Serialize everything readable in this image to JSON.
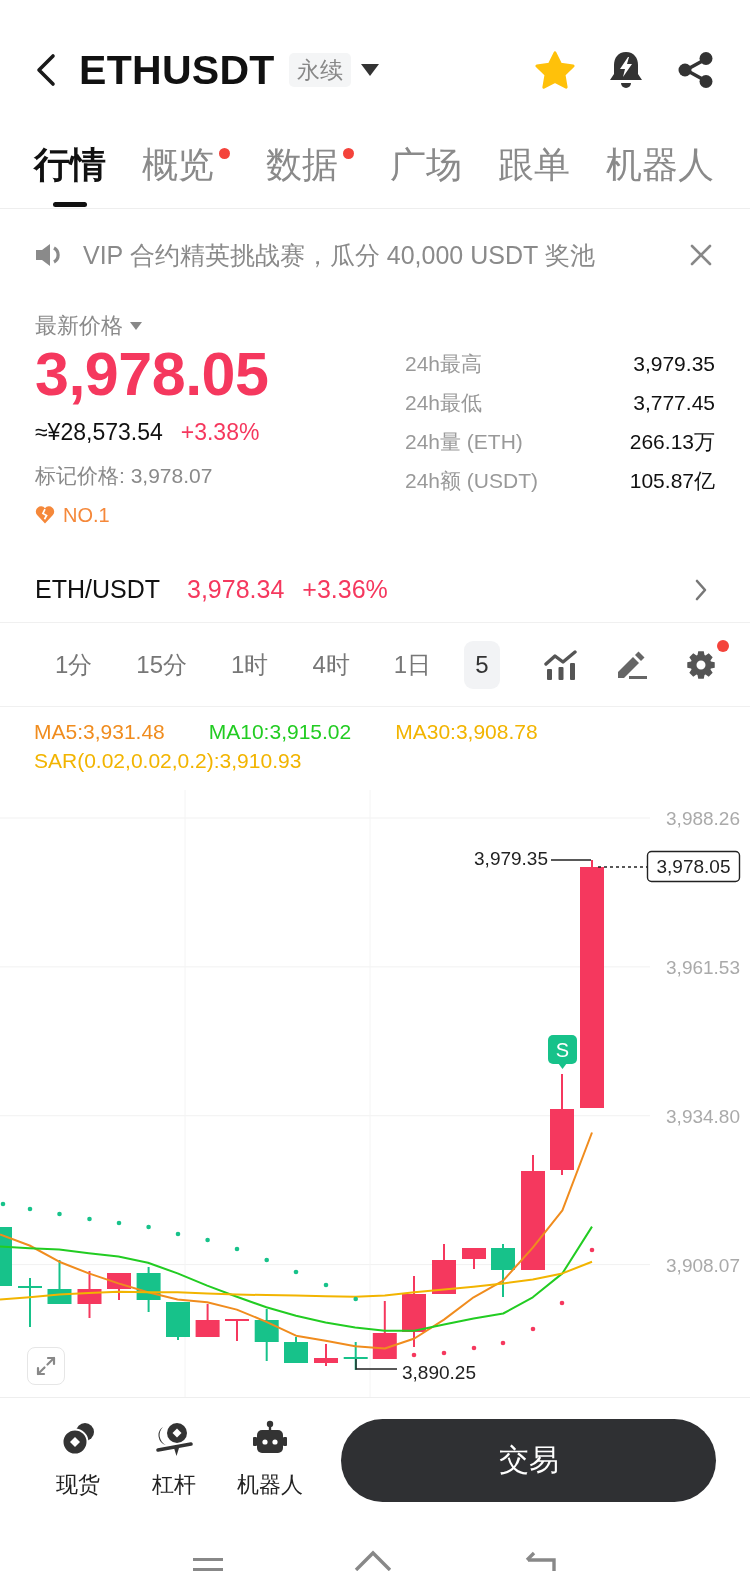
{
  "header": {
    "symbol": "ETHUSDT",
    "tag": "永续",
    "favorited": true
  },
  "tabs": [
    {
      "label": "行情",
      "selected": true,
      "dot": false
    },
    {
      "label": "概览",
      "selected": false,
      "dot": true
    },
    {
      "label": "数据",
      "selected": false,
      "dot": true
    },
    {
      "label": "广场",
      "selected": false,
      "dot": false
    },
    {
      "label": "跟单",
      "selected": false,
      "dot": false
    },
    {
      "label": "机器人",
      "selected": false,
      "dot": false
    }
  ],
  "announcement": {
    "text": "VIP 合约精英挑战赛，瓜分 40,000 USDT 奖池"
  },
  "price": {
    "label": "最新价格",
    "last": "3,978.05",
    "cny": "≈¥28,573.54",
    "change": "+3.38%",
    "mark": "标记价格: 3,978.07",
    "rank": "NO.1"
  },
  "stats": [
    {
      "label": "24h最高",
      "value": "3,979.35"
    },
    {
      "label": "24h最低",
      "value": "3,777.45"
    },
    {
      "label": "24h量 (ETH)",
      "value": "266.13万"
    },
    {
      "label": "24h额 (USDT)",
      "value": "105.87亿"
    }
  ],
  "spot_row": {
    "pair": "ETH/USDT",
    "price": "3,978.34",
    "change": "+3.36%"
  },
  "timeframes": [
    {
      "label": "1分",
      "selected": false
    },
    {
      "label": "15分",
      "selected": false
    },
    {
      "label": "1时",
      "selected": false
    },
    {
      "label": "4时",
      "selected": false
    },
    {
      "label": "1日",
      "selected": false
    },
    {
      "label": "5",
      "selected": true
    }
  ],
  "chart_tools": {
    "settings_dot": true
  },
  "chart": {
    "chart_data": {
      "type": "line",
      "grid": true,
      "ylim": [
        3884.21,
        3988.26
      ],
      "yticks": [
        {
          "value": 3988.26,
          "label": "3,988.26"
        },
        {
          "value": 3961.53,
          "label": "3,961.53"
        },
        {
          "value": 3934.8,
          "label": "3,934.80"
        },
        {
          "value": 3908.07,
          "label": "3,908.07"
        }
      ],
      "series": [
        {
          "name": "MA5:3,931.48",
          "color": "#f08c1e",
          "values": [
            3913.5,
            3911.5,
            3908.6,
            3906.5,
            3904.7,
            3903.1,
            3901.8,
            3901.3,
            3900.0,
            3897.8,
            3895.3,
            3894.4,
            3893.4,
            3893.0,
            3894.8,
            3898.2,
            3902.2,
            3905.2,
            3911.1,
            3917.8,
            3931.8
          ]
        },
        {
          "name": "MA10:3,915.02",
          "color": "#22cc22",
          "values": [
            3911.3,
            3911.0,
            3910.8,
            3910.1,
            3909.5,
            3908.4,
            3906.5,
            3904.3,
            3902.3,
            3900.4,
            3898.9,
            3897.7,
            3896.8,
            3896.2,
            3896.2,
            3897.3,
            3898.4,
            3899.3,
            3902.2,
            3906.5,
            3914.9
          ]
        },
        {
          "name": "MA30:3,908.78",
          "color": "#f2b400",
          "values": [
            3901.8,
            3902.2,
            3902.7,
            3903.0,
            3903.2,
            3903.1,
            3903.1,
            3902.9,
            3902.7,
            3902.6,
            3902.5,
            3902.4,
            3902.3,
            3902.5,
            3903.1,
            3903.6,
            3904.1,
            3904.7,
            3905.4,
            3906.5,
            3908.6
          ]
        }
      ]
    },
    "sar": {
      "label": "SAR(0.02,0.02,0.2):3,910.93",
      "color": "#f2b400"
    },
    "high_label": "3,979.35",
    "last_price": "3,978.05",
    "low_label": "3,890.25",
    "signal": "S"
  },
  "bottom_bar": {
    "items": [
      {
        "label": "现货",
        "kind": "spot"
      },
      {
        "label": "杠杆",
        "kind": "margin"
      },
      {
        "label": "机器人",
        "kind": "bot"
      }
    ],
    "trade_button": "交易"
  }
}
